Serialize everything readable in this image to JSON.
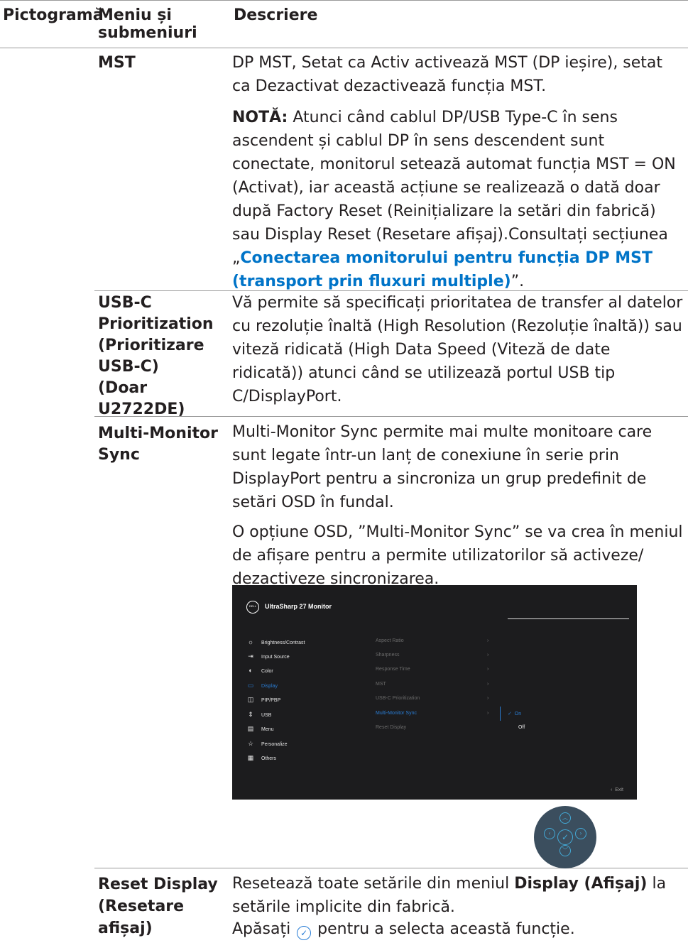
{
  "headers": {
    "icon": "Pictogramă",
    "menu": "Meniu și submeniuri",
    "desc": "Descriere"
  },
  "rows": {
    "mst": {
      "name": "MST",
      "p1": "DP MST, Setat ca Activ activează MST (DP ieșire), setat ca Dezactivat dezactivează funcția MST.",
      "note_label": "NOTĂ:",
      "note_text": " Atunci când cablul DP/USB Type-C în sens ascendent și cablul DP în sens descendent sunt conectate, monitorul setează automat funcția MST = ON (Activat), iar această acțiune se realizează o dată doar după Factory Reset (Reinițializare la setări din fabrică) sau Display Reset (Resetare afișaj).Consultați secțiunea „",
      "link": "Conectarea monitorului pentru funcția DP MST (transport prin fluxuri multiple)",
      "note_end": "”."
    },
    "usbc": {
      "name_lines": [
        "USB-C",
        "Prioritization",
        "(Prioritizare",
        "USB-C)",
        "(Doar",
        "U2722DE)"
      ],
      "desc": "Vă permite să specificați prioritatea de transfer al datelor cu rezoluție înaltă (High Resolution (Rezoluție înaltă)) sau viteză ridicată (High Data Speed (Viteză de date ridicată)) atunci când se utilizează portul USB tip C/DisplayPort."
    },
    "mms": {
      "name_lines": [
        "Multi-Monitor",
        "Sync"
      ],
      "p1": "Multi-Monitor Sync permite mai multe monitoare care sunt legate într-un lanț de conexiune în serie prin DisplayPort pentru a sincroniza un grup predefinit de setări OSD în fundal.",
      "p2": "O opțiune OSD, ”Multi-Monitor Sync” se va crea în meniul de afișare pentru a permite utilizatorilor să activeze/ dezactiveze sincronizarea."
    },
    "reset": {
      "name_lines": [
        "Reset Display",
        "(Resetare",
        "afișaj)"
      ],
      "p1_a": "Resetează toate setările din meniul ",
      "p1_b": "Display (Afișaj)",
      "p1_c": " la setările implicite din fabrică.",
      "p2_a": "Apăsați ",
      "p2_b": " pentru a selecta această funcție."
    }
  },
  "osd": {
    "logo": "DELL",
    "title": "UltraSharp 27 Monitor",
    "menu": [
      {
        "icon": "brightness-icon",
        "glyph": "☼",
        "label": "Brightness/Contrast"
      },
      {
        "icon": "input-source-icon",
        "glyph": "⇥",
        "label": "Input Source"
      },
      {
        "icon": "color-icon",
        "glyph": "◐",
        "label": "Color"
      },
      {
        "icon": "display-icon",
        "glyph": "▭",
        "label": "Display"
      },
      {
        "icon": "pip-pbp-icon",
        "glyph": "◫",
        "label": "PIP/PBP"
      },
      {
        "icon": "usb-icon",
        "glyph": "⇕",
        "label": "USB"
      },
      {
        "icon": "menu-icon",
        "glyph": "▤",
        "label": "Menu"
      },
      {
        "icon": "star-icon",
        "glyph": "☆",
        "label": "Personalize"
      },
      {
        "icon": "others-icon",
        "glyph": "▦",
        "label": "Others"
      }
    ],
    "submenu": [
      "Aspect Ratio",
      "Sharpness",
      "Response Time",
      "MST",
      "USB-C Prioritization",
      "Multi-Monitor Sync",
      "Reset Display"
    ],
    "options": {
      "on": "On",
      "off": "Off"
    },
    "exit": "Exit",
    "accent": "#2a7ed6"
  },
  "colors": {
    "link": "#0074c8",
    "rule": "#9a9a9a"
  }
}
